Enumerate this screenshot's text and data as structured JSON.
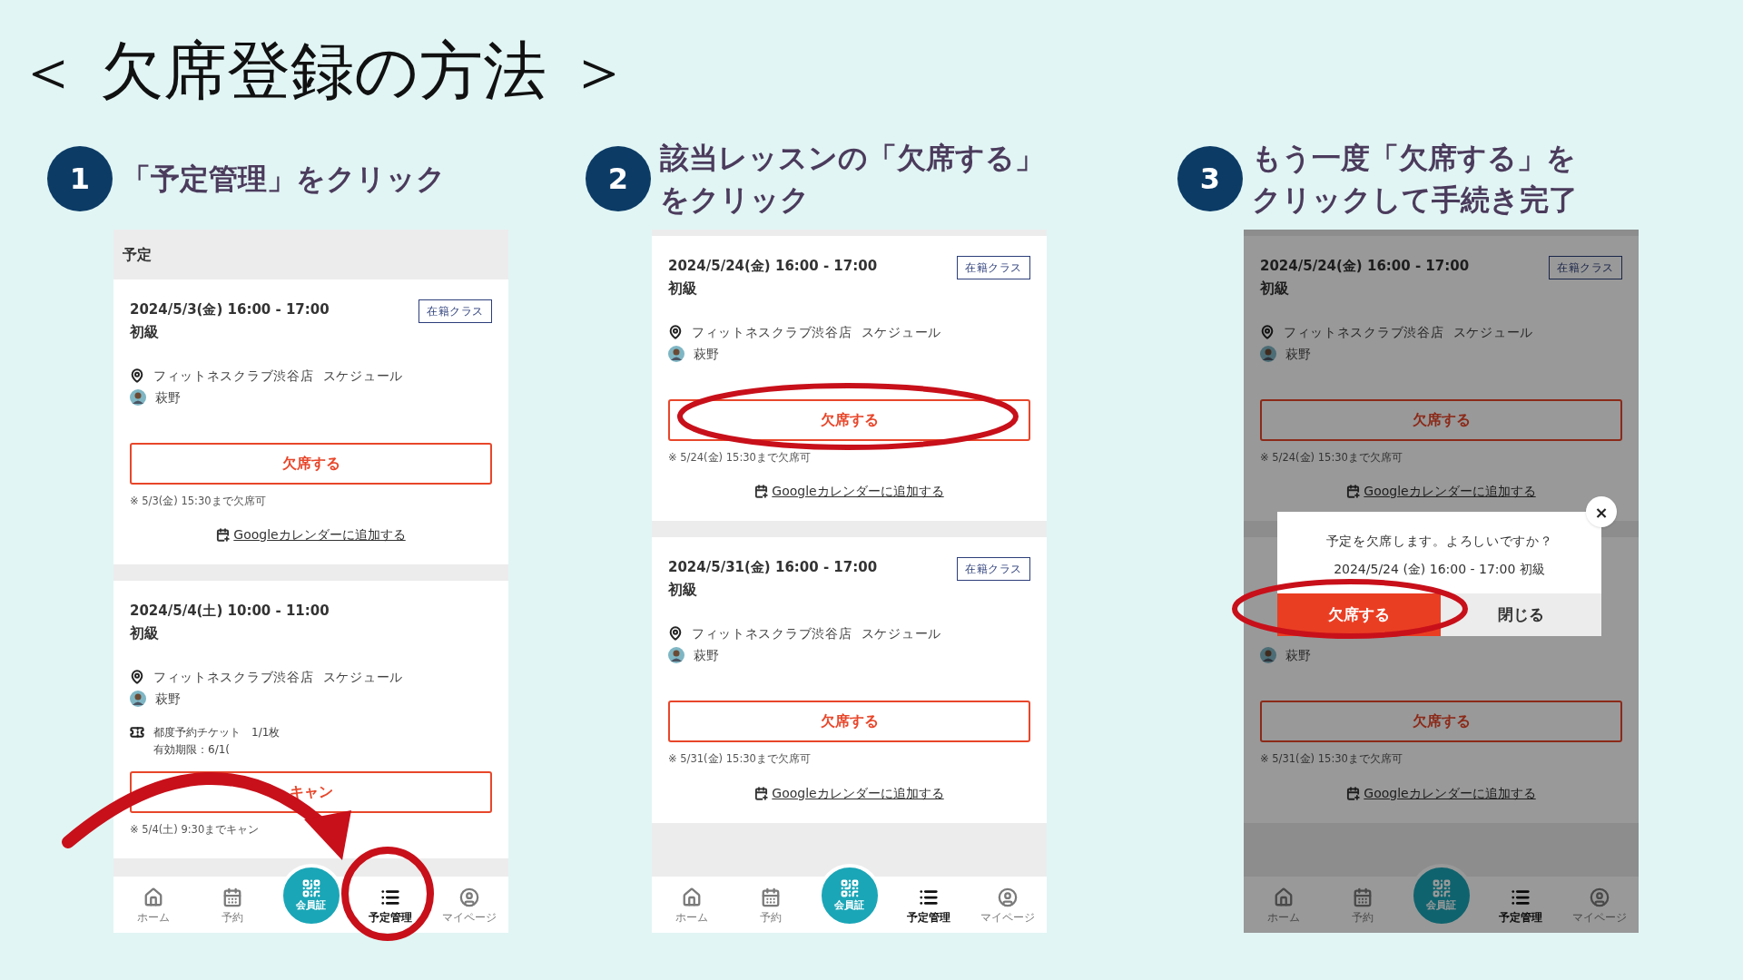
{
  "title": "＜ 欠席登録の方法 ＞",
  "steps": [
    {
      "number": "1",
      "lines": [
        "「予定管理」をクリック"
      ],
      "annotation": {
        "kind": "circle_arrow"
      },
      "phone": {
        "header": "予定",
        "dimmed": false,
        "cards": [
          {
            "date": "2024/5/3(金) 16:00 - 17:00",
            "tag": "在籍クラス",
            "level": "初級",
            "location": "フィットネスクラブ渋谷店  スケジュール",
            "instructor": "萩野",
            "button": "欠席する",
            "note": "※ 5/3(金) 15:30まで欠席可",
            "calendar_link": "Googleカレンダーに追加する"
          },
          {
            "date": "2024/5/4(土) 10:00 - 11:00",
            "level": "初級",
            "location": "フィットネスクラブ渋谷店  スケジュール",
            "instructor": "萩野",
            "ticket": [
              "都度予約チケット　1/1枚",
              "有効期限：6/1("
            ],
            "button": "キャン",
            "note": "※ 5/4(土) 9:30までキャン"
          }
        ],
        "nav": [
          {
            "kind": "home",
            "label": "ホーム",
            "selected": false
          },
          {
            "kind": "calendar",
            "label": "予約",
            "selected": false
          },
          {
            "kind": "qr",
            "label": "会員証",
            "selected": false
          },
          {
            "kind": "list",
            "label": "予定管理",
            "selected": true
          },
          {
            "kind": "user",
            "label": "マイページ",
            "selected": false
          }
        ]
      }
    },
    {
      "number": "2",
      "lines": [
        "該当レッスンの「欠席する」",
        "をクリック"
      ],
      "annotation": {
        "kind": "ellipse"
      },
      "phone": {
        "dimmed": false,
        "cards": [
          {
            "date": "2024/5/24(金) 16:00 - 17:00",
            "tag": "在籍クラス",
            "level": "初級",
            "location": "フィットネスクラブ渋谷店  スケジュール",
            "instructor": "萩野",
            "button": "欠席する",
            "note": "※ 5/24(金) 15:30まで欠席可",
            "calendar_link": "Googleカレンダーに追加する"
          },
          {
            "date": "2024/5/31(金) 16:00 - 17:00",
            "tag": "在籍クラス",
            "level": "初級",
            "location": "フィットネスクラブ渋谷店  スケジュール",
            "instructor": "萩野",
            "button": "欠席する",
            "note": "※ 5/31(金) 15:30まで欠席可",
            "calendar_link": "Googleカレンダーに追加する"
          }
        ],
        "nav": [
          {
            "kind": "home",
            "label": "ホーム",
            "selected": false
          },
          {
            "kind": "calendar",
            "label": "予約",
            "selected": false
          },
          {
            "kind": "qr",
            "label": "会員証",
            "selected": false
          },
          {
            "kind": "list",
            "label": "予定管理",
            "selected": true
          },
          {
            "kind": "user",
            "label": "マイページ",
            "selected": false
          }
        ]
      }
    },
    {
      "number": "3",
      "lines": [
        "もう一度「欠席する」を",
        "クリックして手続き完了"
      ],
      "annotation": {
        "kind": "dialog_ellipse"
      },
      "phone": {
        "dimmed": true,
        "cards": [
          {
            "date": "2024/5/24(金) 16:00 - 17:00",
            "tag": "在籍クラス",
            "level": "初級",
            "location": "フィットネスクラブ渋谷店  スケジュール",
            "instructor": "萩野",
            "button": "欠席する",
            "note": "※ 5/24(金) 15:30まで欠席可",
            "calendar_link": "Googleカレンダーに追加する"
          },
          {
            "instructor": "萩野",
            "button": "欠席する",
            "note": "※ 5/31(金) 15:30まで欠席可",
            "calendar_link": "Googleカレンダーに追加する"
          }
        ],
        "dialog": {
          "message": "予定を欠席します。よろしいですか？",
          "detail": "2024/5/24 (金) 16:00 - 17:00 初級",
          "confirm": "欠席する",
          "cancel": "閉じる",
          "close": "×"
        },
        "nav": [
          {
            "kind": "home",
            "label": "ホーム",
            "selected": false
          },
          {
            "kind": "calendar",
            "label": "予約",
            "selected": false
          },
          {
            "kind": "qr",
            "label": "会員証",
            "selected": false
          },
          {
            "kind": "list",
            "label": "予定管理",
            "selected": true
          },
          {
            "kind": "user",
            "label": "マイページ",
            "selected": false
          }
        ]
      }
    }
  ]
}
